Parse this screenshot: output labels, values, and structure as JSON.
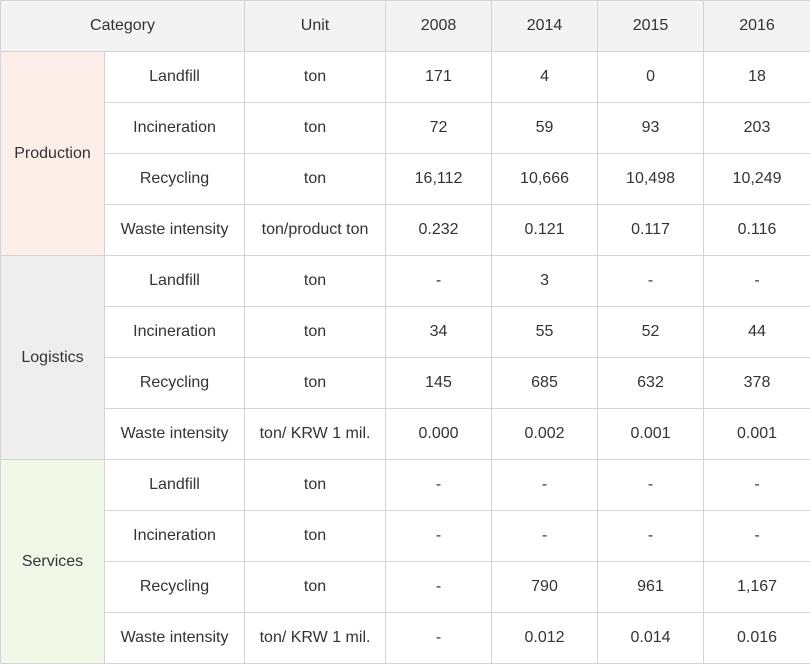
{
  "header": {
    "category": "Category",
    "unit": "Unit",
    "years": [
      "2008",
      "2014",
      "2015",
      "2016"
    ]
  },
  "groups": [
    {
      "name": "Production",
      "color": "#fcefea",
      "rows": [
        {
          "item": "Landfill",
          "unit": "ton",
          "values": [
            "171",
            "4",
            "0",
            "18"
          ]
        },
        {
          "item": "Incineration",
          "unit": "ton",
          "values": [
            "72",
            "59",
            "93",
            "203"
          ]
        },
        {
          "item": "Recycling",
          "unit": "ton",
          "values": [
            "16,112",
            "10,666",
            "10,498",
            "10,249"
          ]
        },
        {
          "item": "Waste intensity",
          "unit": "ton/product ton",
          "values": [
            "0.232",
            "0.121",
            "0.117",
            "0.116"
          ]
        }
      ]
    },
    {
      "name": "Logistics",
      "color": "#eeeeee",
      "rows": [
        {
          "item": "Landfill",
          "unit": "ton",
          "values": [
            "-",
            "3",
            "-",
            "-"
          ]
        },
        {
          "item": "Incineration",
          "unit": "ton",
          "values": [
            "34",
            "55",
            "52",
            "44"
          ]
        },
        {
          "item": "Recycling",
          "unit": "ton",
          "values": [
            "145",
            "685",
            "632",
            "378"
          ]
        },
        {
          "item": "Waste intensity",
          "unit": "ton/ KRW 1 mil.",
          "values": [
            "0.000",
            "0.002",
            "0.001",
            "0.001"
          ]
        }
      ]
    },
    {
      "name": "Services",
      "color": "#f1f8e7",
      "rows": [
        {
          "item": "Landfill",
          "unit": "ton",
          "values": [
            "-",
            "-",
            "-",
            "-"
          ]
        },
        {
          "item": "Incineration",
          "unit": "ton",
          "values": [
            "-",
            "-",
            "-",
            "-"
          ]
        },
        {
          "item": "Recycling",
          "unit": "ton",
          "values": [
            "-",
            "790",
            "961",
            "1,167"
          ]
        },
        {
          "item": "Waste intensity",
          "unit": "ton/ KRW 1 mil.",
          "values": [
            "-",
            "0.012",
            "0.014",
            "0.016"
          ]
        }
      ]
    }
  ]
}
